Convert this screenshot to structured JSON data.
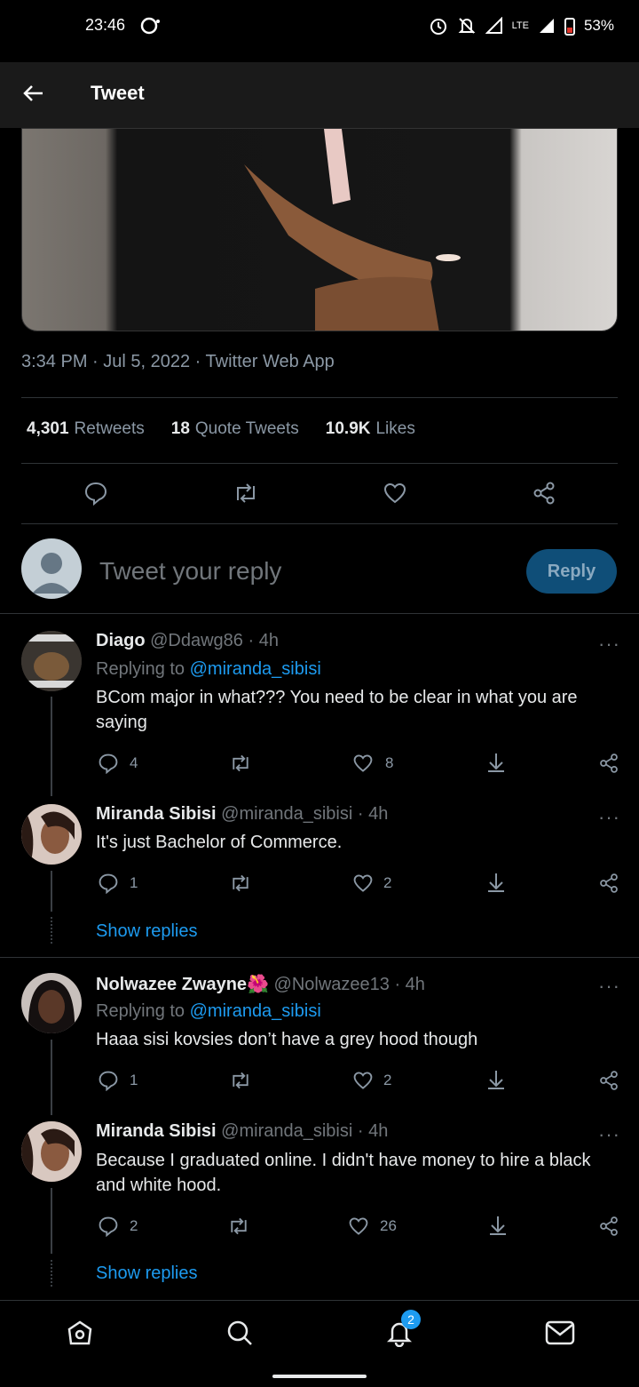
{
  "status_bar": {
    "time": "23:46",
    "battery": "53%",
    "network": "LTE"
  },
  "header": {
    "title": "Tweet"
  },
  "tweet": {
    "meta": "3:34 PM · Jul 5, 2022 · Twitter Web App",
    "retweets_count": "4,301",
    "retweets_label": "Retweets",
    "quotes_count": "18",
    "quotes_label": "Quote Tweets",
    "likes_count": "10.9K",
    "likes_label": "Likes"
  },
  "reply_box": {
    "placeholder": "Tweet your reply",
    "button": "Reply"
  },
  "replies": [
    {
      "name": "Diago",
      "handle": "@Ddawg86 · 4h",
      "replying_prefix": "Replying to ",
      "replying_to": "@miranda_sibisi",
      "text": "BCom major in what??? You need to be clear in what you are saying",
      "replies": "4",
      "likes": "8"
    },
    {
      "name": "Miranda Sibisi",
      "handle": "@miranda_sibisi · 4h",
      "text": "It's just Bachelor of Commerce.",
      "replies": "1",
      "likes": "2"
    },
    {
      "name": "Nolwazee Zwayne🌺",
      "handle": "@Nolwazee13 · 4h",
      "replying_prefix": "Replying to ",
      "replying_to": "@miranda_sibisi",
      "text": "Haaa sisi kovsies don’t have a grey hood though",
      "replies": "1",
      "likes": "2"
    },
    {
      "name": "Miranda Sibisi",
      "handle": "@miranda_sibisi · 4h",
      "text": "Because I graduated online. I didn't have money to hire a black and white hood.",
      "replies": "2",
      "likes": "26"
    }
  ],
  "show_replies": "Show replies",
  "more_glyph": "···",
  "nav": {
    "notifications_badge": "2"
  },
  "colors": {
    "accent": "#1d9bf0",
    "background": "#000000",
    "muted": "#71767b"
  }
}
